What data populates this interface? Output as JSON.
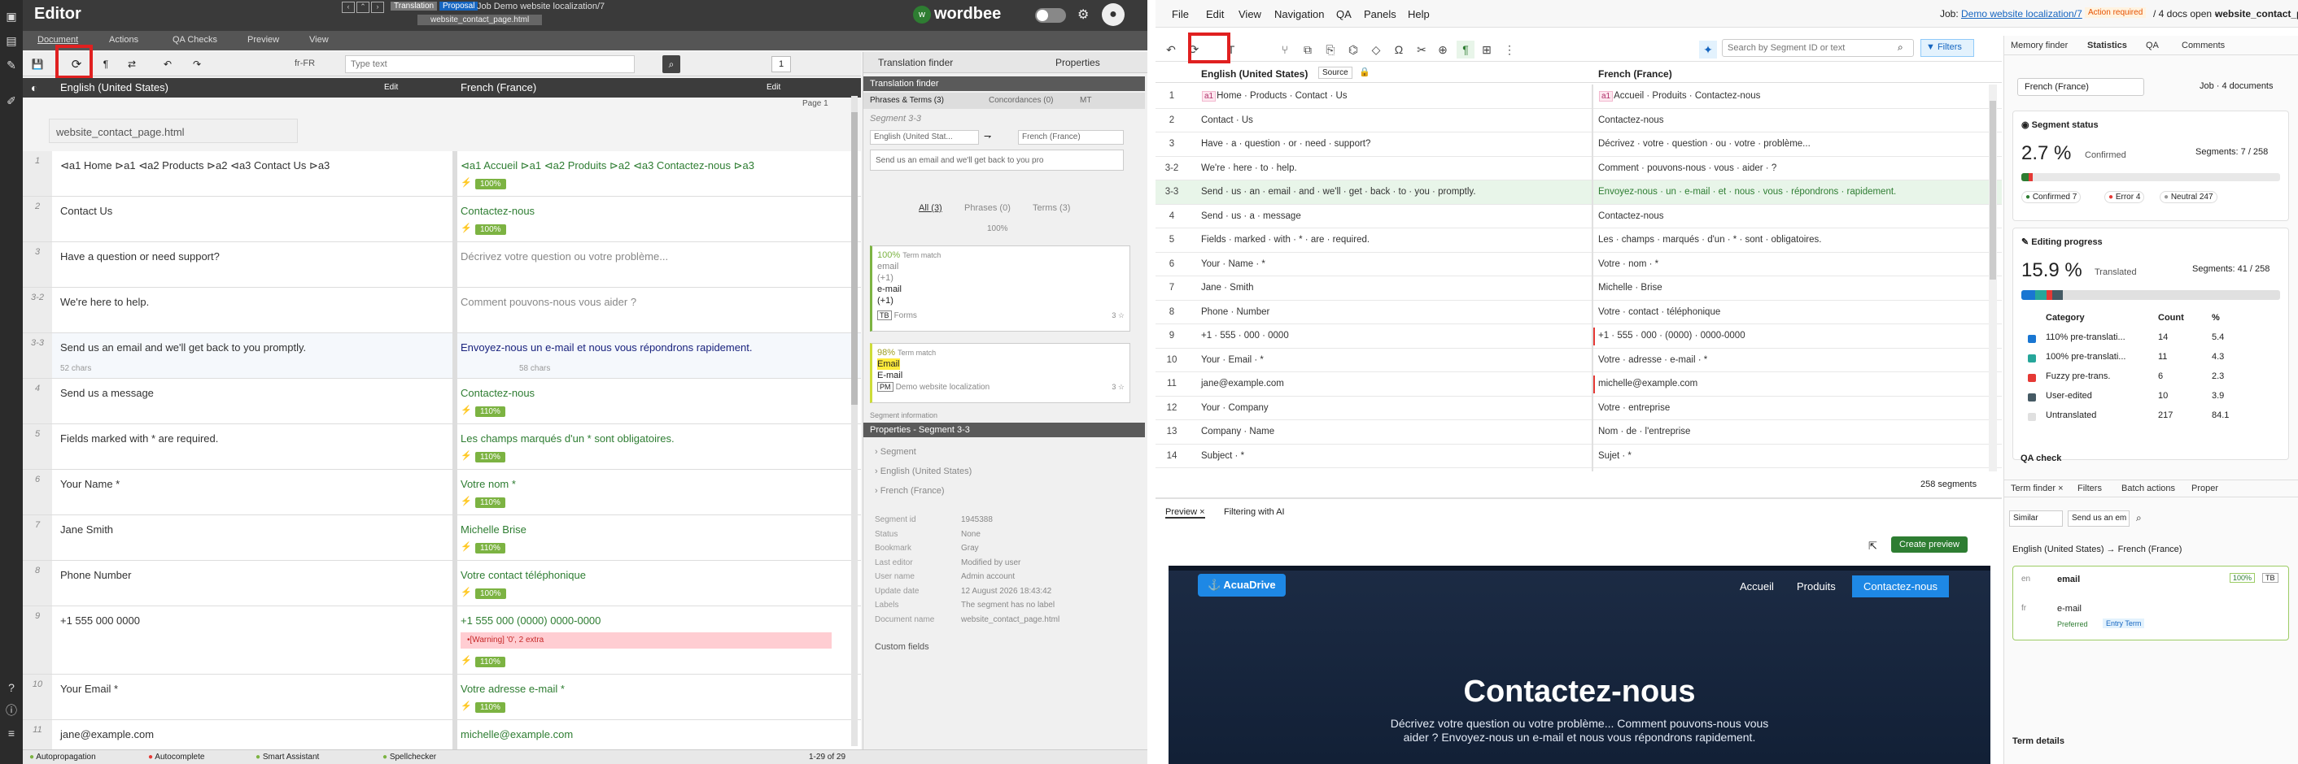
{
  "left": {
    "app_title": "Editor",
    "mode_tabs": [
      "Translation",
      "Proposal"
    ],
    "job_title": "Job Demo website localization/7",
    "doc_tab": "website_contact_page.html",
    "sub_tabs": [
      "Document",
      "Actions",
      "QA Checks",
      "Preview",
      "View"
    ],
    "brand": "wordbee",
    "lang_code": "fr-FR",
    "search_placeholder": "Type text",
    "page_number": "1",
    "panel_tabs": [
      "Translation finder",
      "Properties"
    ],
    "src_lang": "English (United States)",
    "tgt_lang": "French (France)",
    "edit_label": "Edit",
    "page_label": "Page 1",
    "doc_name": "website_contact_page.html",
    "rows": [
      {
        "n": "1",
        "src": "⊲a1 Home ⊳a1 ⊲a2 Products ⊳a2 ⊲a3 Contact Us ⊳a3",
        "tgt": "⊲a1 Accueil ⊳a1 ⊲a2 Produits ⊳a2 ⊲a3 Contactez-nous ⊳a3",
        "badge": "100%"
      },
      {
        "n": "2",
        "src": "Contact Us",
        "tgt": "Contactez-nous",
        "badge": "100%"
      },
      {
        "n": "3",
        "src": "Have a question or need support?",
        "tgt": "Décrivez votre question ou votre problème...",
        "badge": ""
      },
      {
        "n": "3-2",
        "src": "We're here to help.",
        "tgt": "Comment pouvons-nous vous aider ?",
        "badge": ""
      },
      {
        "n": "3-3",
        "src": "Send us an email and we'll get back to you promptly.",
        "tgt": "Envoyez-nous un e-mail et nous vous répondrons rapidement.",
        "badge": "",
        "chars_src": "52 chars",
        "chars_tgt": "58 chars"
      },
      {
        "n": "4",
        "src": "Send us a message",
        "tgt": "Contactez-nous",
        "badge": "110%"
      },
      {
        "n": "5",
        "src": "Fields marked with * are required.",
        "tgt": "Les champs marqués d'un * sont obligatoires.",
        "badge": "110%"
      },
      {
        "n": "6",
        "src": "Your Name *",
        "tgt": "Votre nom *",
        "badge": "110%"
      },
      {
        "n": "7",
        "src": "Jane Smith",
        "tgt": "Michelle Brise",
        "badge": "110%"
      },
      {
        "n": "8",
        "src": "Phone Number",
        "tgt": "Votre contact téléphonique",
        "badge": "100%"
      },
      {
        "n": "9",
        "src": "+1 555 000 0000",
        "tgt": "+1 555 000 (0000) 0000-0000",
        "badge": "110%",
        "warning": "•[Warning] '0', 2 extra"
      },
      {
        "n": "10",
        "src": "Your Email *",
        "tgt": "Votre adresse e-mail *",
        "badge": "110%"
      },
      {
        "n": "11",
        "src": "jane@example.com",
        "tgt": "michelle@example.com",
        "badge": ""
      }
    ],
    "tf": {
      "tabs": [
        "Phrases & Terms (3)",
        "Concordances (0)",
        "MT"
      ],
      "segment": "Segment 3-3",
      "src_sel": "English (United Stat...",
      "tgt_sel": "French (France)",
      "query": "Send us an email and we'll get back to you pro",
      "filters": [
        "All (3)",
        "Phrases (0)",
        "Terms (3)"
      ],
      "pct": "100%",
      "m1": {
        "pct": "100%",
        "kind": "Term match",
        "l1": "email",
        "l2": "(+1)",
        "l3": "e-mail",
        "l4": "(+1)",
        "src": "TB",
        "srcname": "Forms",
        "score": "3 ☆"
      },
      "m2": {
        "pct": "98%",
        "kind": "Term match",
        "l1": "Email",
        "l2": "E-mail",
        "src": "PM",
        "srcname": "Demo website localization",
        "score": "3 ☆"
      },
      "seginfo": "Segment information"
    },
    "props": {
      "title": "Properties - Segment 3-3",
      "sections": [
        "Segment",
        "English (United States)",
        "French (France)"
      ],
      "fields": [
        [
          "Segment id",
          "1945388"
        ],
        [
          "Status",
          "None"
        ],
        [
          "Bookmark",
          "Gray"
        ],
        [
          "Last editor",
          "Modified by user"
        ],
        [
          "User name",
          "Admin account"
        ],
        [
          "Update date",
          "12 August 2026 18:43:42"
        ],
        [
          "Labels",
          "The segment has no label"
        ],
        [
          "Document name",
          "website_contact_page.html"
        ]
      ],
      "custom": "Custom fields"
    },
    "status": {
      "items": [
        "Autopropagation",
        "Autocomplete",
        "Smart Assistant",
        "Spellchecker"
      ],
      "count": "1-29 of 29"
    }
  },
  "right": {
    "menu": [
      "File",
      "Edit",
      "View",
      "Navigation",
      "QA",
      "Panels",
      "Help"
    ],
    "job_label": "Job:",
    "job_link": "Demo website localization/7",
    "action": "Action required",
    "docs": "/ 4 docs open -",
    "doc": "website_contact_page.html",
    "search_placeholder": "Search by Segment ID or text",
    "filters": "Filters",
    "src_lang": "English (United States)",
    "source_btn": "Source",
    "tgt_lang": "French (France)",
    "rows": [
      {
        "n": "1",
        "s": "Home · Products · Contact · Us",
        "t": "Accueil · Produits · Contactez-nous",
        "tags": true
      },
      {
        "n": "2",
        "s": "Contact · Us",
        "t": "Contactez-nous"
      },
      {
        "n": "3",
        "s": "Have · a · question · or · need · support?",
        "t": "Décrivez · votre · question · ou · votre · problème..."
      },
      {
        "n": "3-2",
        "s": "We're · here · to · help.",
        "t": "Comment · pouvons-nous · vous · aider · ?"
      },
      {
        "n": "3-3",
        "s": "Send · us · an · email · and · we'll · get · back · to · you · promptly.",
        "t": "Envoyez-nous · un · e-mail · et · nous · vous · répondrons · rapidement.",
        "sel": true
      },
      {
        "n": "4",
        "s": "Send · us · a · message",
        "t": "Contactez-nous"
      },
      {
        "n": "5",
        "s": "Fields · marked · with · * · are · required.",
        "t": "Les · champs · marqués · d'un · * · sont · obligatoires."
      },
      {
        "n": "6",
        "s": "Your · Name · *",
        "t": "Votre · nom · *"
      },
      {
        "n": "7",
        "s": "Jane · Smith",
        "t": "Michelle · Brise"
      },
      {
        "n": "8",
        "s": "Phone · Number",
        "t": "Votre · contact · téléphonique"
      },
      {
        "n": "9",
        "s": "+1 · 555 · 000 · 0000",
        "t": "+1 · 555 · 000 · (0000) · 0000-0000",
        "err": true
      },
      {
        "n": "10",
        "s": "Your · Email · *",
        "t": "Votre · adresse · e-mail · *"
      },
      {
        "n": "11",
        "s": "jane@example.com",
        "t": "michelle@example.com",
        "err": true
      },
      {
        "n": "12",
        "s": "Your · Company",
        "t": "Votre · entreprise"
      },
      {
        "n": "13",
        "s": "Company · Name",
        "t": "Nom · de · l'entreprise"
      },
      {
        "n": "14",
        "s": "Subject · *",
        "t": "Sujet · *"
      }
    ],
    "seg_count": "258 segments",
    "preview_tabs": [
      "Preview",
      "Filtering with AI"
    ],
    "create_preview": "Create preview",
    "site": {
      "brand": "AcuaDrive",
      "nav": [
        "Accueil",
        "Produits",
        "Contactez-nous"
      ],
      "hero": "Contactez-nous",
      "sub": "Décrivez votre question ou votre problème... Comment pouvons-nous vous aider ? Envoyez-nous un e-mail et nous vous répondrons rapidement."
    },
    "side_tabs": [
      "Memory finder",
      "Statistics",
      "QA",
      "Comments"
    ],
    "lang_sel": "French (France)",
    "job_docs": "Job · 4 documents",
    "seg_status": {
      "title": "Segment status",
      "pct": "2.7 %",
      "label": "Confirmed",
      "segs": "Segments: 7 / 258",
      "chips": [
        "Confirmed 7",
        "Error 4",
        "Neutral 247"
      ]
    },
    "edit_prog": {
      "title": "Editing progress",
      "pct": "15.9 %",
      "label": "Translated",
      "segs": "Segments: 41 / 258",
      "headers": [
        "Category",
        "Count",
        "%"
      ],
      "rows": [
        [
          "110% pre-translati...",
          "14",
          "5.4",
          "#1976d2"
        ],
        [
          "100% pre-translati...",
          "11",
          "4.3",
          "#26a69a"
        ],
        [
          "Fuzzy pre-trans.",
          "6",
          "2.3",
          "#e53935"
        ],
        [
          "User-edited",
          "10",
          "3.9",
          "#455a64"
        ],
        [
          "Untranslated",
          "217",
          "84.1",
          "#e0e0e0"
        ]
      ]
    },
    "qa": "QA check",
    "term_tabs": [
      "Term finder",
      "Filters",
      "Batch actions",
      "Proper"
    ],
    "term_mode": "Similar",
    "term_query": "Send us an em",
    "term_langs": "English (United States) → French (France)",
    "term": {
      "en_code": "en",
      "en": "email",
      "pct": "100%",
      "tb": "TB",
      "fr_code": "fr",
      "fr": "e-mail",
      "preferred": "Preferred",
      "entry": "Entry Term"
    },
    "term_details": "Term details"
  }
}
